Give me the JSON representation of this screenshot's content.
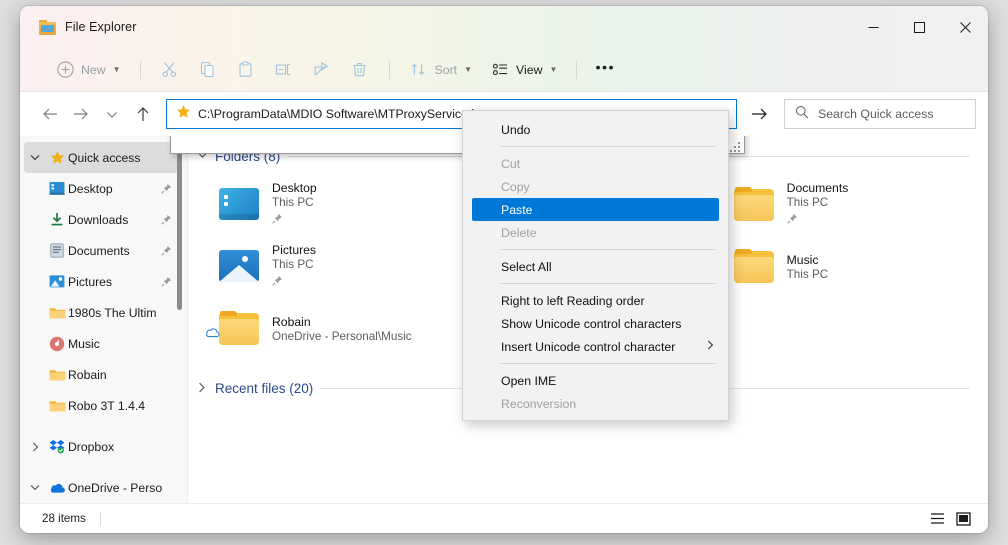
{
  "window": {
    "title": "File Explorer",
    "icon": "folder-icon",
    "controls": {
      "minimize": "minimize-icon",
      "maximize": "maximize-icon",
      "close": "close-icon"
    }
  },
  "commandbar": {
    "new_label": "New",
    "sort_label": "Sort",
    "view_label": "View",
    "more_label": "•••",
    "icons": {
      "new": "plus-circle-icon",
      "cut": "scissors-icon",
      "copy": "copy-icon",
      "paste": "paste-icon",
      "rename": "rename-icon",
      "share": "share-icon",
      "delete": "trash-icon",
      "sort": "sort-arrows-icon",
      "view": "view-list-icon"
    }
  },
  "navbar": {
    "back": "back-arrow-icon",
    "forward": "forward-arrow-icon",
    "recent": "chevron-down-icon",
    "up": "up-arrow-icon",
    "address_value": "C:\\ProgramData\\MDIO Software\\MTProxyService.log",
    "address_star": "star-icon",
    "address_chevron": "chevron-down-icon",
    "go": "go-arrow-icon",
    "search_placeholder": "Search Quick access",
    "search_icon": "search-icon"
  },
  "sidebar": {
    "items": [
      {
        "label": "Quick access",
        "icon": "star-icon",
        "expander": "chevron-down",
        "pinned": false,
        "selected": true,
        "indent": 0
      },
      {
        "label": "Desktop",
        "icon": "desktop-icon",
        "expander": "",
        "pinned": true,
        "selected": false,
        "indent": 1
      },
      {
        "label": "Downloads",
        "icon": "download-icon",
        "expander": "",
        "pinned": true,
        "selected": false,
        "indent": 1
      },
      {
        "label": "Documents",
        "icon": "documents-icon",
        "expander": "",
        "pinned": true,
        "selected": false,
        "indent": 1
      },
      {
        "label": "Pictures",
        "icon": "pictures-icon",
        "expander": "",
        "pinned": true,
        "selected": false,
        "indent": 1
      },
      {
        "label": "1980s The Ultim",
        "icon": "folder-icon",
        "expander": "",
        "pinned": false,
        "selected": false,
        "indent": 1
      },
      {
        "label": "Music",
        "icon": "music-icon",
        "expander": "",
        "pinned": false,
        "selected": false,
        "indent": 1
      },
      {
        "label": "Robain",
        "icon": "folder-icon",
        "expander": "",
        "pinned": false,
        "selected": false,
        "indent": 1
      },
      {
        "label": "Robo 3T 1.4.4",
        "icon": "folder-icon",
        "expander": "",
        "pinned": false,
        "selected": false,
        "indent": 1
      },
      {
        "label": "Dropbox",
        "icon": "dropbox-icon",
        "expander": "chevron-right",
        "pinned": false,
        "selected": false,
        "indent": 0
      },
      {
        "label": "OneDrive - Perso",
        "icon": "onedrive-icon",
        "expander": "chevron-down",
        "pinned": false,
        "selected": false,
        "indent": 0
      }
    ]
  },
  "content": {
    "groups": [
      {
        "title": "Folders (8)",
        "expanded": true,
        "chevron": "chevron-down"
      },
      {
        "title": "Recent files (20)",
        "expanded": false,
        "chevron": "chevron-right"
      }
    ],
    "tiles": [
      {
        "name": "Desktop",
        "sub": "This PC",
        "icon": "desktop-folder-icon",
        "pinned": true,
        "cloud": false
      },
      {
        "name": "",
        "sub": "",
        "icon": "excel-folder-icon",
        "pinned": false,
        "cloud": false
      },
      {
        "name": "Documents",
        "sub": "This PC",
        "icon": "folder-icon",
        "pinned": true,
        "cloud": false
      },
      {
        "name": "Pictures",
        "sub": "This PC",
        "icon": "pictures-folder-icon",
        "pinned": true,
        "cloud": false
      },
      {
        "name": "",
        "sub": "",
        "icon": "folder-icon",
        "pinned": false,
        "cloud": false
      },
      {
        "name": "Music",
        "sub": "This PC",
        "icon": "folder-icon",
        "pinned": true,
        "cloud": false
      },
      {
        "name": "Robain",
        "sub": "OneDrive - Personal\\Music",
        "icon": "folder-icon",
        "pinned": false,
        "cloud": true
      },
      {
        "name": "",
        "sub": "",
        "icon": "folder-icon",
        "pinned": false,
        "cloud": false
      }
    ]
  },
  "context_menu": {
    "items": [
      {
        "label": "Undo",
        "state": "enabled",
        "submenu": false,
        "sep_after": true
      },
      {
        "label": "Cut",
        "state": "disabled",
        "submenu": false,
        "sep_after": false
      },
      {
        "label": "Copy",
        "state": "disabled",
        "submenu": false,
        "sep_after": false
      },
      {
        "label": "Paste",
        "state": "highlight",
        "submenu": false,
        "sep_after": false
      },
      {
        "label": "Delete",
        "state": "disabled",
        "submenu": false,
        "sep_after": true
      },
      {
        "label": "Select All",
        "state": "enabled",
        "submenu": false,
        "sep_after": true
      },
      {
        "label": "Right to left Reading order",
        "state": "enabled",
        "submenu": false,
        "sep_after": false
      },
      {
        "label": "Show Unicode control characters",
        "state": "enabled",
        "submenu": false,
        "sep_after": false
      },
      {
        "label": "Insert Unicode control character",
        "state": "enabled",
        "submenu": true,
        "sep_after": true
      },
      {
        "label": "Open IME",
        "state": "enabled",
        "submenu": false,
        "sep_after": false
      },
      {
        "label": "Reconversion",
        "state": "disabled",
        "submenu": false,
        "sep_after": false
      }
    ],
    "highlight_color": "#0078d7",
    "submenu_marker": "chevron-right-icon"
  },
  "statusbar": {
    "item_count": "28 items",
    "views": [
      {
        "icon": "list-view-icon",
        "active": false
      },
      {
        "icon": "detail-view-icon",
        "active": true
      }
    ]
  }
}
